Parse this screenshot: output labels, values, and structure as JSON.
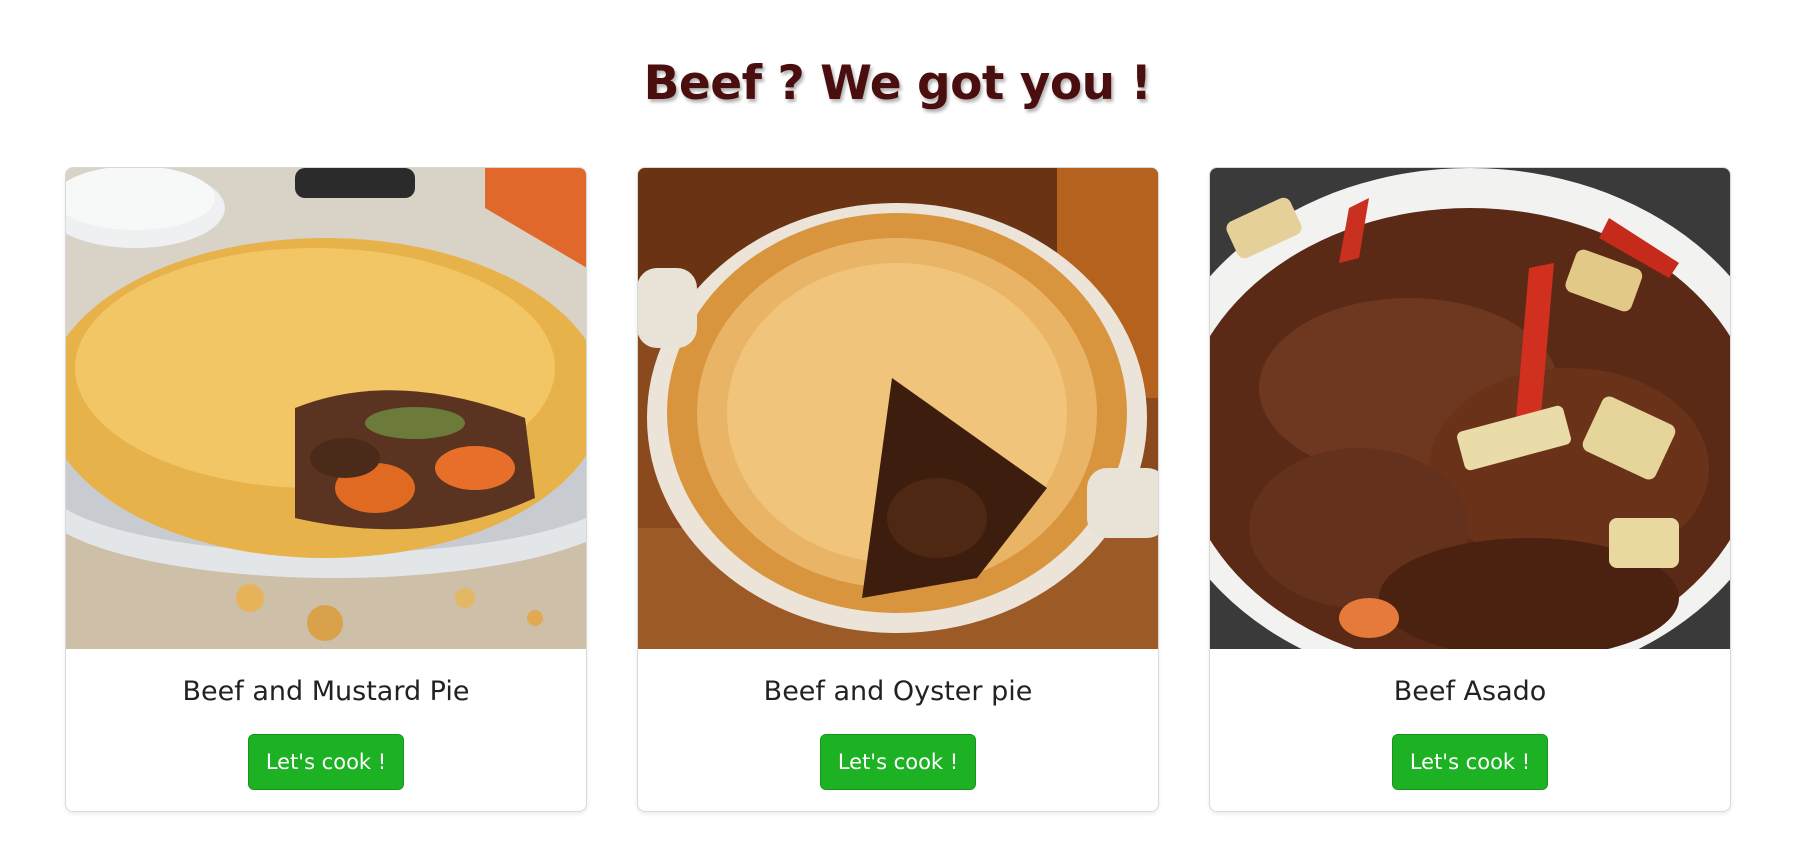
{
  "heading": "Beef ? We got you !",
  "cards": [
    {
      "title": "Beef and Mustard Pie",
      "button": "Let's cook !",
      "image": "beef-and-mustard-pie-photo"
    },
    {
      "title": "Beef and Oyster pie",
      "button": "Let's cook !",
      "image": "beef-and-oyster-pie-photo"
    },
    {
      "title": "Beef Asado",
      "button": "Let's cook !",
      "image": "beef-asado-photo"
    }
  ],
  "colors": {
    "heading": "#4a0e0e",
    "button": "#1db224",
    "button_text": "#ffffff"
  }
}
